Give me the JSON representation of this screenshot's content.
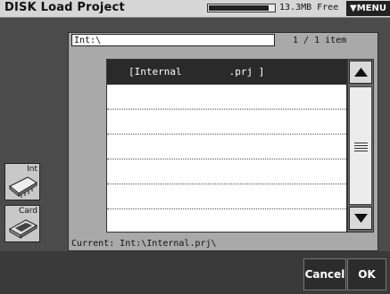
{
  "window": {
    "title": "DISK Load Project"
  },
  "disk": {
    "free_text": "13.3MB Free",
    "used_fraction": 0.92
  },
  "menu": {
    "label": "▼MENU"
  },
  "browser": {
    "path": "Int:\\",
    "item_count": "1 / 1 item",
    "items": [
      {
        "name": "[Internal        .prj ]",
        "selected": true
      },
      {
        "name": ""
      },
      {
        "name": ""
      },
      {
        "name": ""
      },
      {
        "name": ""
      },
      {
        "name": ""
      },
      {
        "name": ""
      }
    ],
    "current_label": "Current: Int:\\Internal.prj\\"
  },
  "devices": [
    {
      "label": "Int",
      "icon": "internal-drive-icon"
    },
    {
      "label": "Card",
      "icon": "memory-card-icon"
    }
  ],
  "actions": {
    "cancel": "Cancel",
    "ok": "OK"
  },
  "colors": {
    "selected_row": "#2a2a2a",
    "background": "#4b4b4b",
    "panel": "#a9a9a9"
  }
}
